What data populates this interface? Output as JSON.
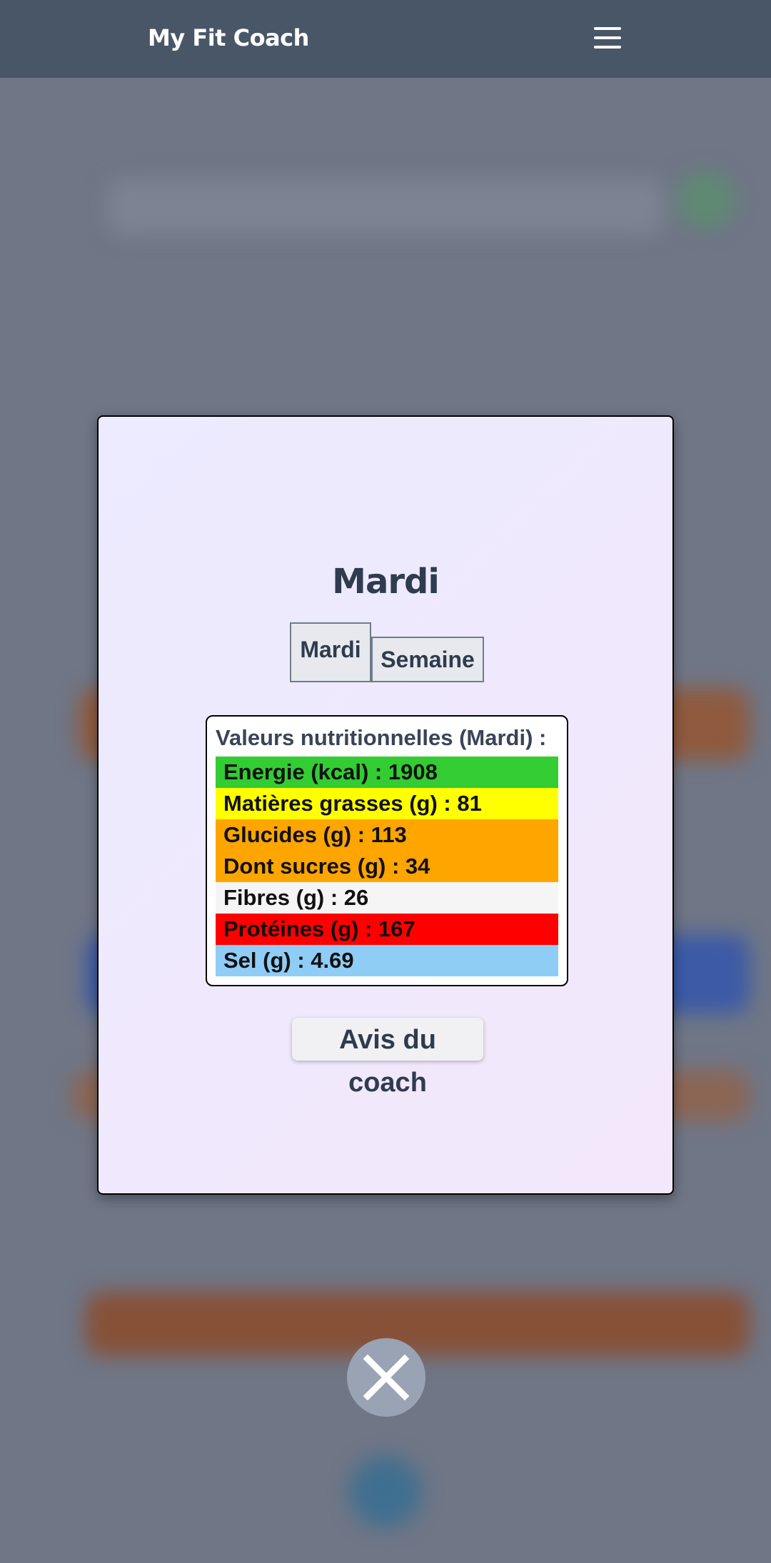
{
  "header": {
    "brand": "My Fit Coach",
    "menu_icon": "hamburger-menu-icon",
    "background": "#485668"
  },
  "modal": {
    "title": "Mardi",
    "tabs": [
      {
        "label": "Mardi",
        "active": true
      },
      {
        "label": "Semaine",
        "active": false
      }
    ],
    "nutrition": {
      "title": "Valeurs nutritionnelles (Mardi) :",
      "rows": [
        {
          "label": "Energie (kcal) : 1908",
          "color": "#33cc33"
        },
        {
          "label": "Matières grasses (g) : 81",
          "color": "#ffff00"
        },
        {
          "label": "Glucides (g) : 113",
          "color": "#ffa500"
        },
        {
          "label": "Dont sucres (g) : 34",
          "color": "#ffa500"
        },
        {
          "label": "Fibres (g) : 26",
          "color": "#f5f5f5"
        },
        {
          "label": "Protéines (g) : 167",
          "color": "#ff0000"
        },
        {
          "label": "Sel (g) : 4.69",
          "color": "#8fcdf7"
        }
      ]
    },
    "coach_button": "Avis du coach"
  },
  "close_button": {
    "icon": "close-icon"
  }
}
